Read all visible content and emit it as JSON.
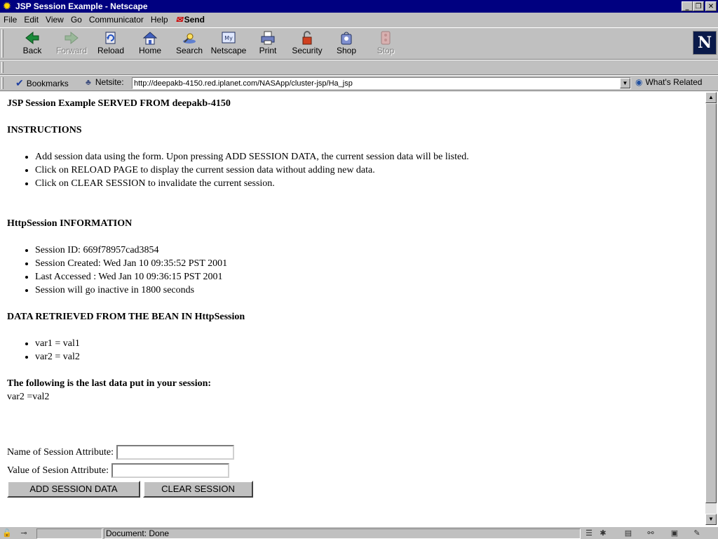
{
  "window": {
    "title": "JSP Session Example - Netscape",
    "controls": {
      "minimize": "_",
      "maximize": "❐",
      "close": "✕"
    }
  },
  "menu": {
    "items": [
      {
        "label": "File"
      },
      {
        "label": "Edit"
      },
      {
        "label": "View"
      },
      {
        "label": "Go"
      },
      {
        "label": "Communicator"
      },
      {
        "label": "Help"
      }
    ],
    "send": "Send"
  },
  "toolbar": {
    "back": "Back",
    "forward": "Forward",
    "reload": "Reload",
    "home": "Home",
    "search": "Search",
    "netscape": "Netscape",
    "print": "Print",
    "security": "Security",
    "shop": "Shop",
    "stop": "Stop",
    "netscape_icon_text": "My",
    "logo_letter": "N"
  },
  "location": {
    "bookmarks": "Bookmarks",
    "netsite_label": "Netsite:",
    "url": "http://deepakb-4150.red.iplanet.com/NASApp/cluster-jsp/Ha_jsp",
    "whats_related": "What's Related"
  },
  "page": {
    "heading": "JSP Session Example SERVED FROM deepakb-4150",
    "instructions_heading": "INSTRUCTIONS",
    "instructions": [
      "Add session data using the form. Upon pressing ADD SESSION DATA, the current session data will be listed.",
      "Click on RELOAD PAGE to display the current session data without adding new data.",
      "Click on CLEAR SESSION to invalidate the current session."
    ],
    "httpsession_heading": "HttpSession INFORMATION",
    "session_info": [
      "Session ID: 669f78957cad3854",
      "Session Created: Wed Jan 10 09:35:52 PST 2001",
      "Last Accessed : Wed Jan 10 09:36:15 PST 2001",
      "Session will go inactive in 1800 seconds"
    ],
    "bean_heading": "DATA RETRIEVED FROM THE BEAN IN HttpSession",
    "bean_data": [
      "var1 = val1",
      "var2 = val2"
    ],
    "last_data_heading": "The following is the last data put in your session:",
    "last_data": "var2 =val2",
    "form": {
      "name_label": "Name of Session Attribute:",
      "name_value": "",
      "value_label": "Value of Sesion Attribute:",
      "value_value": "",
      "add_button": "ADD SESSION DATA",
      "clear_button": "CLEAR SESSION"
    }
  },
  "status": {
    "text": "Document: Done"
  },
  "colors": {
    "titlebar": "#000080",
    "chrome": "#c0c0c0",
    "page_bg": "#ffffff"
  }
}
